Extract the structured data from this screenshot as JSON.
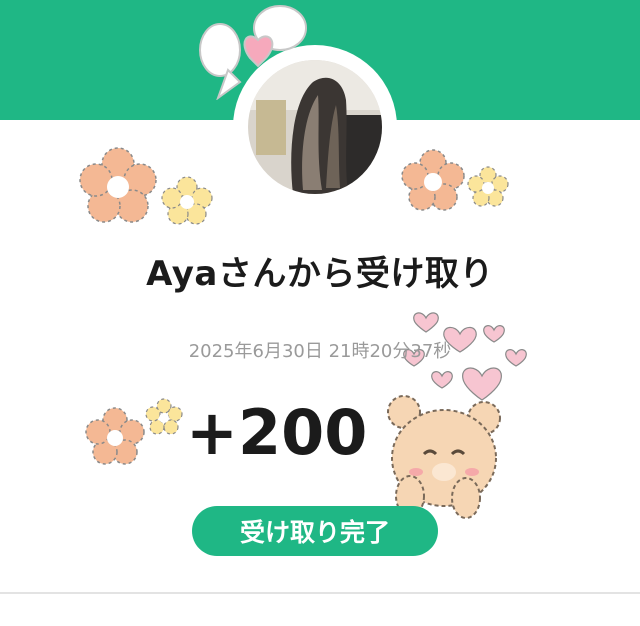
{
  "receipt": {
    "title": "Ayaさんから受け取り",
    "timestamp": "2025年6月30日 21時20分37秒",
    "amount": "+200",
    "status_label": "受け取り完了"
  },
  "colors": {
    "accent": "#1fb785",
    "text": "#1b1b1b",
    "muted": "#9a9a9a"
  },
  "icons": [
    "ribbon-icon",
    "flower-icon",
    "heart-icon",
    "bear-sticker-icon",
    "avatar"
  ]
}
